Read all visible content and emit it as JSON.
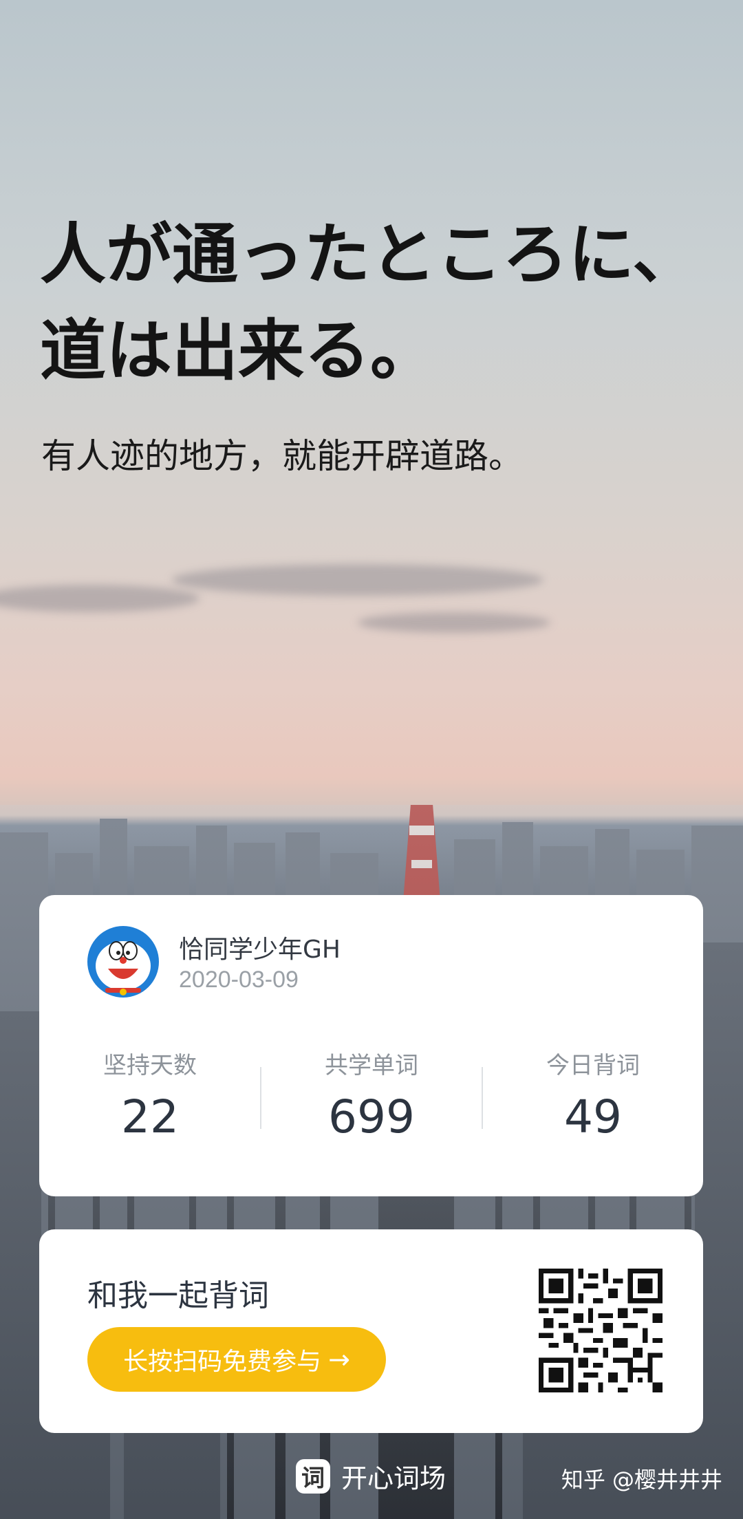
{
  "hero": {
    "headline_line1": "人が通ったところに、",
    "headline_line2": "道は出来る。",
    "subline": "有人迹的地方，就能开辟道路。"
  },
  "profile": {
    "username": "恰同学少年GH",
    "date": "2020-03-09",
    "avatar_icon": "doraemon-avatar"
  },
  "stats": [
    {
      "label": "坚持天数",
      "value": "22"
    },
    {
      "label": "共学单词",
      "value": "699"
    },
    {
      "label": "今日背词",
      "value": "49"
    }
  ],
  "invite": {
    "title": "和我一起背词",
    "cta_label": "长按扫码免费参与",
    "cta_arrow": "→",
    "qr_icon": "qr-code"
  },
  "footer": {
    "brand_icon_glyph": "词",
    "brand_name": "开心词场",
    "watermark": "知乎 @樱井井井"
  },
  "colors": {
    "accent": "#f7bd0f",
    "card_bg": "#ffffff",
    "text_dark": "#2c3440",
    "text_muted": "#8d939a"
  }
}
